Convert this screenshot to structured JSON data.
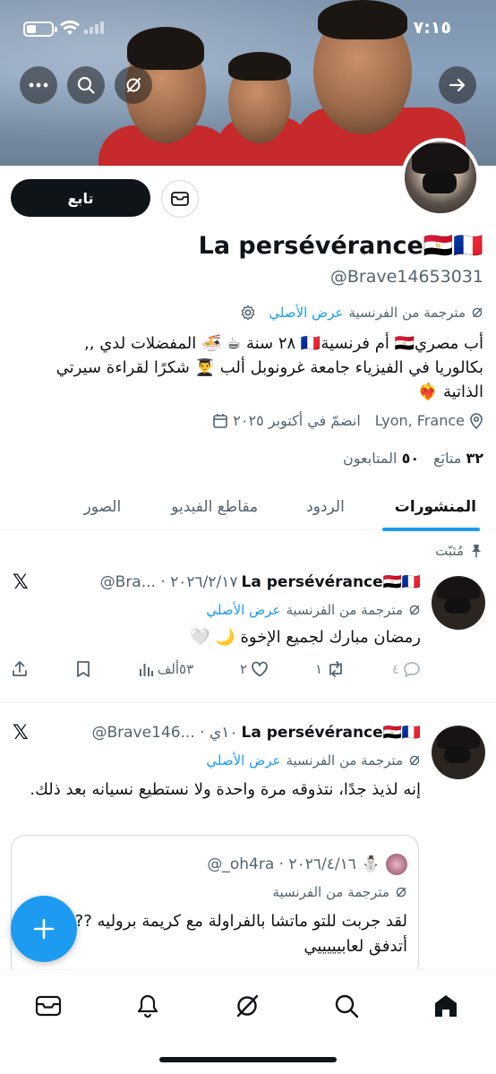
{
  "status": {
    "time": "٧:١٥"
  },
  "profile": {
    "follow_label": "تابع",
    "name": "La persévérance🇪🇬🇫🇷",
    "handle": "@Brave14653031",
    "translated_from": "مترجمة من الفرنسية",
    "show_original": "عرض الأصلي",
    "bio_line1": "أب مصري🇪🇬 أم فرنسية🇫🇷 ٢٨ سنة ☕ 🍜 المفضلات لدي ,,",
    "bio_line2": "بكالوريا في الفيزياء جامعة غرونوبل ألب 👨‍🎓 شكرًا لقراءة سيرتي",
    "bio_line3": "الذاتية ❤️‍🔥",
    "location": "Lyon, France",
    "joined": "انضمّ في أكتوبر ٢٠٢٥",
    "following_count": "٣٢",
    "following_label": "متابَع",
    "followers_count": "٥٠",
    "followers_label": "المتابعون"
  },
  "tabs": [
    {
      "label": "المنشورات",
      "active": true
    },
    {
      "label": "الردود",
      "active": false
    },
    {
      "label": "مقاطع الفيديو",
      "active": false
    },
    {
      "label": "الصور",
      "active": false
    }
  ],
  "pinned_label": "مُثبّت",
  "posts": [
    {
      "name": "La persévérance🇪🇬🇫🇷",
      "sub": "@Bra... · ٢٠٢٦/٢/١٧",
      "translated_from": "مترجمة من الفرنسية",
      "show_original": "عرض الأصلي",
      "text": "رمضان مبارك لجميع الإخوة 🌙 🤍",
      "replies": "٤",
      "reposts": "١",
      "likes": "٢",
      "views": "٥٣ألف"
    },
    {
      "name": "La persévérance🇪🇬🇫🇷",
      "sub": "@Brave146... · ١٠ي",
      "translated_from": "مترجمة من الفرنسية",
      "show_original": "عرض الأصلي",
      "text": "إنه لذيذ جدًا، نتذوقه مرة واحدة ولا نستطيع نسيانه بعد ذلك.",
      "quote": {
        "handle": "@_oh4ra · ٢٠٢٦/٤/١٦",
        "emoji": "⛄",
        "translated_from": "مترجمة من الفرنسية",
        "text": "لقد جربت للتو ماتشا بالفراولة مع كريمة بروليه ???? أنا أتدفق لعابيييييي"
      }
    }
  ],
  "colors": {
    "accent": "#1d9bf0",
    "text": "#0f1419",
    "muted": "#536471"
  }
}
